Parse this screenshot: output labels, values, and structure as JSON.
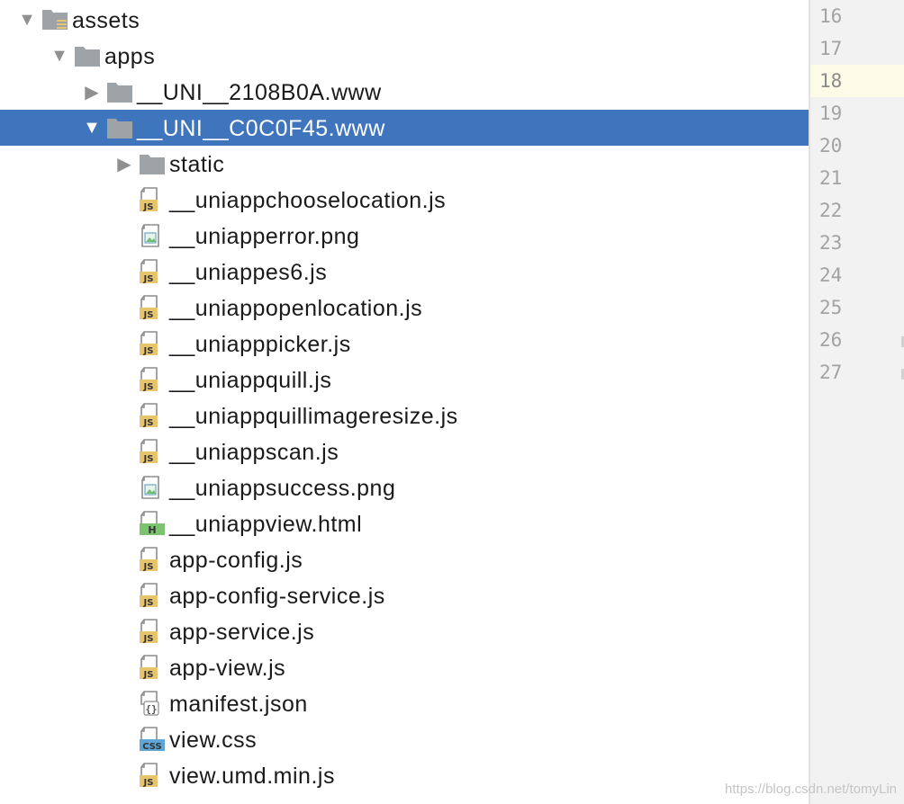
{
  "colors": {
    "selection": "#3e75bc",
    "folder": "#9ea3a8",
    "js_badge": "#e8c46c",
    "html_badge": "#7cc26f",
    "css_badge": "#5ea6d6",
    "gutter_bg": "#f2f2f2",
    "current_line_bg": "#fbfbe8"
  },
  "tree": {
    "rows": [
      {
        "label": "assets",
        "depth": 0,
        "arrow": "expanded",
        "icon": "assets-folder-icon",
        "selected": false
      },
      {
        "label": "apps",
        "depth": 1,
        "arrow": "expanded",
        "icon": "folder-icon",
        "selected": false
      },
      {
        "label": "__UNI__2108B0A.www",
        "depth": 2,
        "arrow": "collapsed",
        "icon": "folder-icon",
        "selected": false
      },
      {
        "label": "__UNI__C0C0F45.www",
        "depth": 2,
        "arrow": "expanded",
        "icon": "folder-icon",
        "selected": true
      },
      {
        "label": "static",
        "depth": 3,
        "arrow": "collapsed",
        "icon": "folder-icon",
        "selected": false
      },
      {
        "label": "__uniappchooselocation.js",
        "depth": 3,
        "arrow": "none",
        "icon": "js-file-icon",
        "selected": false
      },
      {
        "label": "__uniapperror.png",
        "depth": 3,
        "arrow": "none",
        "icon": "image-file-icon",
        "selected": false
      },
      {
        "label": "__uniappes6.js",
        "depth": 3,
        "arrow": "none",
        "icon": "js-file-icon",
        "selected": false
      },
      {
        "label": "__uniappopenlocation.js",
        "depth": 3,
        "arrow": "none",
        "icon": "js-file-icon",
        "selected": false
      },
      {
        "label": "__uniapppicker.js",
        "depth": 3,
        "arrow": "none",
        "icon": "js-file-icon",
        "selected": false
      },
      {
        "label": "__uniappquill.js",
        "depth": 3,
        "arrow": "none",
        "icon": "js-file-icon",
        "selected": false
      },
      {
        "label": "__uniappquillimageresize.js",
        "depth": 3,
        "arrow": "none",
        "icon": "js-file-icon",
        "selected": false
      },
      {
        "label": "__uniappscan.js",
        "depth": 3,
        "arrow": "none",
        "icon": "js-file-icon",
        "selected": false
      },
      {
        "label": "__uniappsuccess.png",
        "depth": 3,
        "arrow": "none",
        "icon": "image-file-icon",
        "selected": false
      },
      {
        "label": "__uniappview.html",
        "depth": 3,
        "arrow": "none",
        "icon": "html-file-icon",
        "selected": false
      },
      {
        "label": "app-config.js",
        "depth": 3,
        "arrow": "none",
        "icon": "js-file-icon",
        "selected": false
      },
      {
        "label": "app-config-service.js",
        "depth": 3,
        "arrow": "none",
        "icon": "js-file-icon",
        "selected": false
      },
      {
        "label": "app-service.js",
        "depth": 3,
        "arrow": "none",
        "icon": "js-file-icon",
        "selected": false
      },
      {
        "label": "app-view.js",
        "depth": 3,
        "arrow": "none",
        "icon": "js-file-icon",
        "selected": false
      },
      {
        "label": "manifest.json",
        "depth": 3,
        "arrow": "none",
        "icon": "json-file-icon",
        "selected": false
      },
      {
        "label": "view.css",
        "depth": 3,
        "arrow": "none",
        "icon": "css-file-icon",
        "selected": false
      },
      {
        "label": "view.umd.min.js",
        "depth": 3,
        "arrow": "none",
        "icon": "js-file-icon",
        "selected": false
      }
    ],
    "badges": {
      "js": "JS",
      "html": "H",
      "css": "CSS",
      "json": "{}"
    }
  },
  "gutter": {
    "line_numbers": [
      "16",
      "17",
      "18",
      "19",
      "20",
      "21",
      "22",
      "23",
      "24",
      "25",
      "26",
      "27"
    ],
    "current_line": "18"
  },
  "watermark": "https://blog.csdn.net/tomyLin"
}
